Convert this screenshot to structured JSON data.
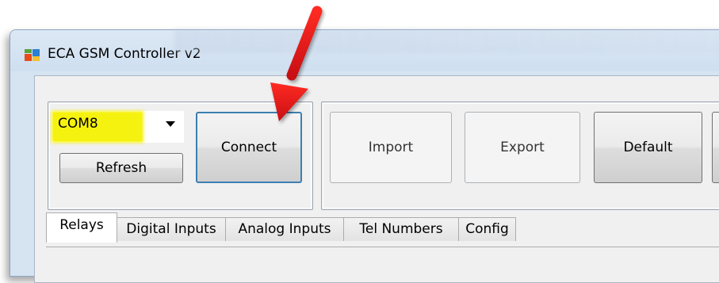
{
  "window": {
    "title": "ECA GSM Controller v2",
    "accent": "#d6e3f1"
  },
  "connection": {
    "port_value": "COM8",
    "highlight_color": "#f6f20f",
    "connect_label": "Connect",
    "refresh_label": "Refresh"
  },
  "toolbar": {
    "import_label": "Import",
    "export_label": "Export",
    "default_label": "Default"
  },
  "tabs": [
    {
      "label": "Relays",
      "active": true
    },
    {
      "label": "Digital Inputs",
      "active": false
    },
    {
      "label": "Analog Inputs",
      "active": false
    },
    {
      "label": "Tel Numbers",
      "active": false
    },
    {
      "label": "Config",
      "active": false
    }
  ],
  "annotation": {
    "arrow_color": "#e8141a"
  }
}
